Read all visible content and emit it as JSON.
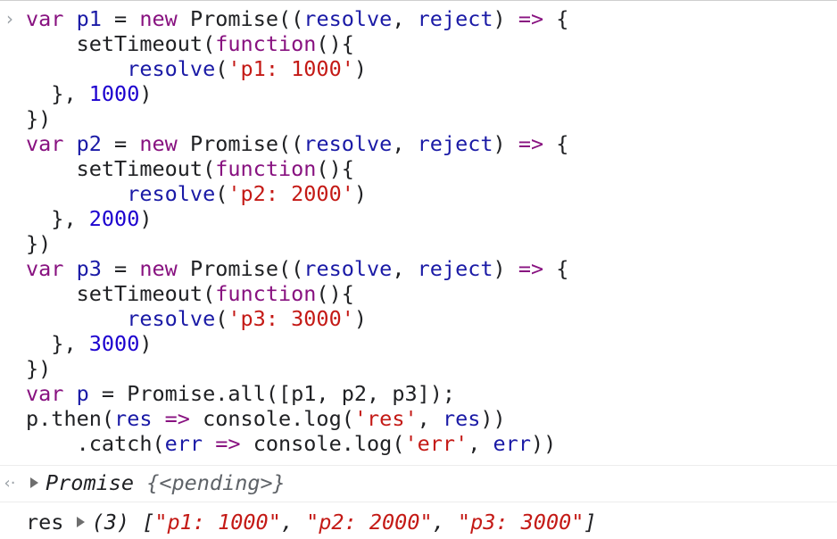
{
  "console": {
    "input_prompt": "›",
    "return_prompt": "‹·",
    "code_lines": [
      [
        {
          "t": "var",
          "c": "kw"
        },
        {
          "t": " ",
          "c": "plain"
        },
        {
          "t": "p1",
          "c": "var"
        },
        {
          "t": " = ",
          "c": "plain"
        },
        {
          "t": "new",
          "c": "kw"
        },
        {
          "t": " Promise((",
          "c": "plain"
        },
        {
          "t": "resolve",
          "c": "var"
        },
        {
          "t": ", ",
          "c": "plain"
        },
        {
          "t": "reject",
          "c": "var"
        },
        {
          "t": ") ",
          "c": "plain"
        },
        {
          "t": "=>",
          "c": "op"
        },
        {
          "t": " {",
          "c": "plain"
        }
      ],
      [
        {
          "t": "    setTimeout(",
          "c": "plain"
        },
        {
          "t": "function",
          "c": "kw"
        },
        {
          "t": "(){",
          "c": "plain"
        }
      ],
      [
        {
          "t": "        ",
          "c": "plain"
        },
        {
          "t": "resolve",
          "c": "var"
        },
        {
          "t": "(",
          "c": "plain"
        },
        {
          "t": "'p1: 1000'",
          "c": "str"
        },
        {
          "t": ")",
          "c": "plain"
        }
      ],
      [
        {
          "t": "  }, ",
          "c": "plain"
        },
        {
          "t": "1000",
          "c": "num"
        },
        {
          "t": ")",
          "c": "plain"
        }
      ],
      [
        {
          "t": "})",
          "c": "plain"
        }
      ],
      [
        {
          "t": "var",
          "c": "kw"
        },
        {
          "t": " ",
          "c": "plain"
        },
        {
          "t": "p2",
          "c": "var"
        },
        {
          "t": " = ",
          "c": "plain"
        },
        {
          "t": "new",
          "c": "kw"
        },
        {
          "t": " Promise((",
          "c": "plain"
        },
        {
          "t": "resolve",
          "c": "var"
        },
        {
          "t": ", ",
          "c": "plain"
        },
        {
          "t": "reject",
          "c": "var"
        },
        {
          "t": ") ",
          "c": "plain"
        },
        {
          "t": "=>",
          "c": "op"
        },
        {
          "t": " {",
          "c": "plain"
        }
      ],
      [
        {
          "t": "    setTimeout(",
          "c": "plain"
        },
        {
          "t": "function",
          "c": "kw"
        },
        {
          "t": "(){",
          "c": "plain"
        }
      ],
      [
        {
          "t": "        ",
          "c": "plain"
        },
        {
          "t": "resolve",
          "c": "var"
        },
        {
          "t": "(",
          "c": "plain"
        },
        {
          "t": "'p2: 2000'",
          "c": "str"
        },
        {
          "t": ")",
          "c": "plain"
        }
      ],
      [
        {
          "t": "  }, ",
          "c": "plain"
        },
        {
          "t": "2000",
          "c": "num"
        },
        {
          "t": ")",
          "c": "plain"
        }
      ],
      [
        {
          "t": "})",
          "c": "plain"
        }
      ],
      [
        {
          "t": "var",
          "c": "kw"
        },
        {
          "t": " ",
          "c": "plain"
        },
        {
          "t": "p3",
          "c": "var"
        },
        {
          "t": " = ",
          "c": "plain"
        },
        {
          "t": "new",
          "c": "kw"
        },
        {
          "t": " Promise((",
          "c": "plain"
        },
        {
          "t": "resolve",
          "c": "var"
        },
        {
          "t": ", ",
          "c": "plain"
        },
        {
          "t": "reject",
          "c": "var"
        },
        {
          "t": ") ",
          "c": "plain"
        },
        {
          "t": "=>",
          "c": "op"
        },
        {
          "t": " {",
          "c": "plain"
        }
      ],
      [
        {
          "t": "    setTimeout(",
          "c": "plain"
        },
        {
          "t": "function",
          "c": "kw"
        },
        {
          "t": "(){",
          "c": "plain"
        }
      ],
      [
        {
          "t": "        ",
          "c": "plain"
        },
        {
          "t": "resolve",
          "c": "var"
        },
        {
          "t": "(",
          "c": "plain"
        },
        {
          "t": "'p3: 3000'",
          "c": "str"
        },
        {
          "t": ")",
          "c": "plain"
        }
      ],
      [
        {
          "t": "  }, ",
          "c": "plain"
        },
        {
          "t": "3000",
          "c": "num"
        },
        {
          "t": ")",
          "c": "plain"
        }
      ],
      [
        {
          "t": "})",
          "c": "plain"
        }
      ],
      [
        {
          "t": "var",
          "c": "kw"
        },
        {
          "t": " ",
          "c": "plain"
        },
        {
          "t": "p",
          "c": "var"
        },
        {
          "t": " = Promise.all([p1, p2, p3]);",
          "c": "plain"
        }
      ],
      [
        {
          "t": "p.then(",
          "c": "plain"
        },
        {
          "t": "res",
          "c": "var"
        },
        {
          "t": " ",
          "c": "plain"
        },
        {
          "t": "=>",
          "c": "op"
        },
        {
          "t": " console.log(",
          "c": "plain"
        },
        {
          "t": "'res'",
          "c": "str"
        },
        {
          "t": ", ",
          "c": "plain"
        },
        {
          "t": "res",
          "c": "var"
        },
        {
          "t": "))",
          "c": "plain"
        }
      ],
      [
        {
          "t": "    .catch(",
          "c": "plain"
        },
        {
          "t": "err",
          "c": "var"
        },
        {
          "t": " ",
          "c": "plain"
        },
        {
          "t": "=>",
          "c": "op"
        },
        {
          "t": " console.log(",
          "c": "plain"
        },
        {
          "t": "'err'",
          "c": "str"
        },
        {
          "t": ", ",
          "c": "plain"
        },
        {
          "t": "err",
          "c": "var"
        },
        {
          "t": "))",
          "c": "plain"
        }
      ]
    ],
    "return_entry": {
      "object_name": "Promise",
      "object_value": " {<pending>}"
    },
    "log_entry": {
      "label": "res",
      "array_length": "(3)",
      "open_bracket": " [",
      "items": [
        "\"p1: 1000\"",
        "\"p2: 2000\"",
        "\"p3: 3000\""
      ],
      "separator": ", ",
      "close_bracket": "]"
    }
  }
}
